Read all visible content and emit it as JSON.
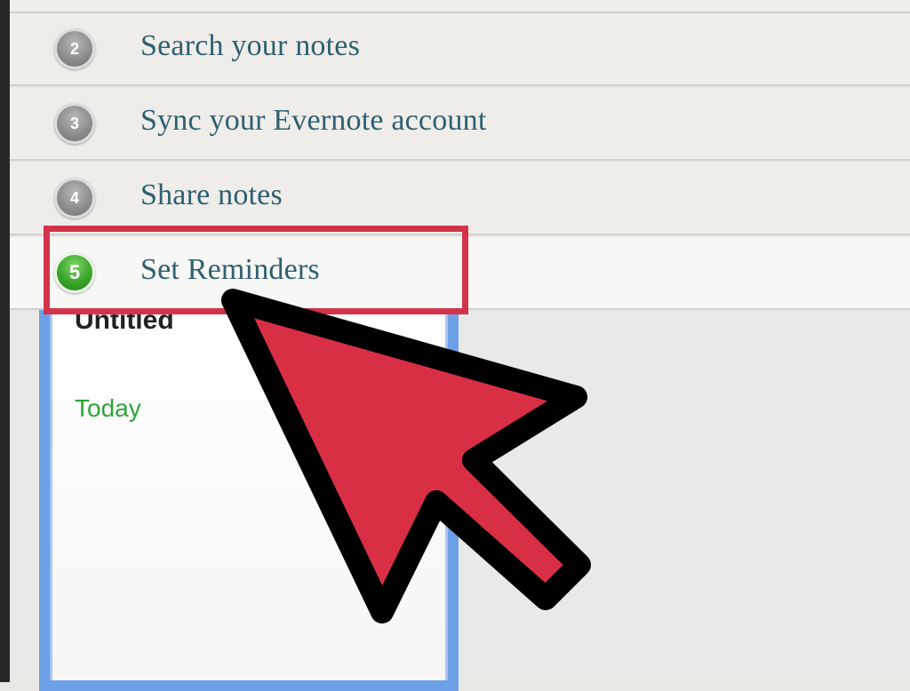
{
  "steps": [
    {
      "number": "2",
      "label": "Search your notes"
    },
    {
      "number": "3",
      "label": "Sync your Evernote account"
    },
    {
      "number": "4",
      "label": "Share notes"
    },
    {
      "number": "5",
      "label": "Set Reminders"
    }
  ],
  "note": {
    "title": "Untitled",
    "date": "Today"
  },
  "colors": {
    "accent_red": "#d3334a",
    "step_text": "#2f5f71",
    "active_badge": "#3aa52b",
    "inactive_badge": "#8e8e8e",
    "note_border": "#6d9fe6",
    "date_text": "#2fa33a"
  },
  "icons": {
    "cursor": "arrow-cursor-icon",
    "highlight": "highlight-box"
  }
}
